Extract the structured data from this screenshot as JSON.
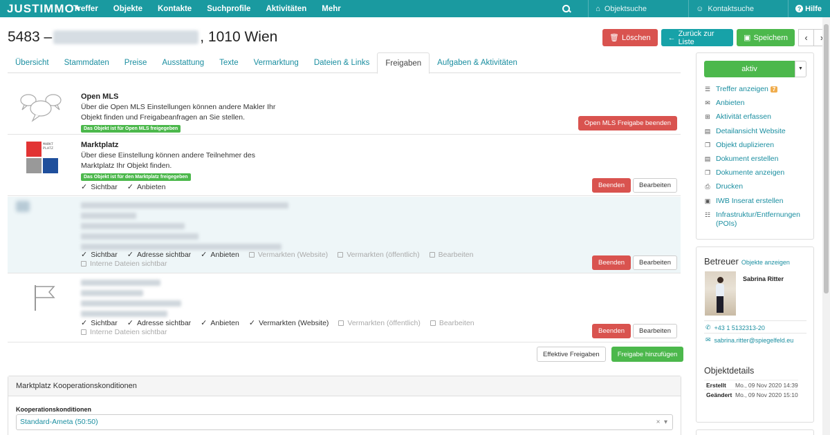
{
  "nav": {
    "brand": "JUSTIMMO",
    "items": [
      "Treffer",
      "Objekte",
      "Kontakte",
      "Suchprofile",
      "Aktivitäten",
      "Mehr"
    ],
    "object_search_placeholder": "Objektsuche",
    "contact_search_placeholder": "Kontaktsuche",
    "help": "Hilfe",
    "color": "#1a9aa0"
  },
  "title": {
    "number": "5483 –",
    "location": ", 1010 Wien"
  },
  "actions": {
    "delete": "Löschen",
    "back": "Zurück zur Liste",
    "save": "Speichern"
  },
  "tabs": [
    "Übersicht",
    "Stammdaten",
    "Preise",
    "Ausstattung",
    "Texte",
    "Vermarktung",
    "Dateien & Links",
    "Freigaben",
    "Aufgaben & Aktivitäten"
  ],
  "active_tab": "Freigaben",
  "open_mls": {
    "title": "Open MLS",
    "desc1": "Über die Open MLS Einstellungen können andere Makler Ihr",
    "desc2": "Objekt finden und Freigabeanfragen an Sie stellen.",
    "badge": "Das Objekt ist für Open MLS freigegeben",
    "button": "Open MLS Freigabe beenden"
  },
  "marktplatz": {
    "title": "Marktplatz",
    "desc1": "Über diese Einstellung können andere Teilnehmer des",
    "desc2": "Marktplatz Ihr Objekt finden.",
    "badge": "Das Objekt ist für den Marktplatz freigegeben",
    "logo_text": "MARKT PLATZ",
    "checks": [
      "Sichtbar",
      "Anbieten"
    ],
    "end_button": "Beenden",
    "edit_button": "Bearbeiten"
  },
  "share3": {
    "checks_on": [
      "Sichtbar",
      "Adresse sichtbar",
      "Anbieten"
    ],
    "checks_off": [
      "Vermarkten (Website)",
      "Vermarkten (öffentlich)",
      "Bearbeiten",
      "Interne Dateien sichtbar"
    ],
    "end_button": "Beenden",
    "edit_button": "Bearbeiten"
  },
  "share4": {
    "checks_on": [
      "Sichtbar",
      "Adresse sichtbar",
      "Anbieten",
      "Vermarkten (Website)"
    ],
    "checks_off": [
      "Vermarkten (öffentlich)",
      "Bearbeiten",
      "Interne Dateien sichtbar"
    ],
    "end_button": "Beenden",
    "edit_button": "Bearbeiten"
  },
  "footer_buttons": {
    "effective": "Effektive Freigaben",
    "add": "Freigabe hinzufügen"
  },
  "cooperation": {
    "heading": "Marktplatz Kooperationskonditionen",
    "label": "Kooperationskonditionen",
    "value": "Standard-Ameta (50:50)"
  },
  "sidebar": {
    "status": "aktiv",
    "links": [
      {
        "icon": "list-icon",
        "glyph": "☰",
        "label": "Treffer anzeigen",
        "count": "7"
      },
      {
        "icon": "envelope-icon",
        "glyph": "✉",
        "label": "Anbieten"
      },
      {
        "icon": "plus-square-icon",
        "glyph": "⊞",
        "label": "Aktivität erfassen"
      },
      {
        "icon": "file-icon",
        "glyph": "▤",
        "label": "Detailansicht Website"
      },
      {
        "icon": "copy-icon",
        "glyph": "❐",
        "label": "Objekt duplizieren"
      },
      {
        "icon": "file-icon",
        "glyph": "▤",
        "label": "Dokument erstellen"
      },
      {
        "icon": "copy-icon",
        "glyph": "❐",
        "label": "Dokumente anzeigen"
      },
      {
        "icon": "print-icon",
        "glyph": "⎙",
        "label": "Drucken"
      },
      {
        "icon": "newspaper-icon",
        "glyph": "▣",
        "label": "IWB Inserat erstellen"
      },
      {
        "icon": "poi-icon",
        "glyph": "☷",
        "label": "Infrastruktur/Entfernungen (POIs)"
      }
    ],
    "agent_heading": "Betreuer",
    "agent_link": "Objekte anzeigen",
    "agent_name": "Sabrina Ritter",
    "agent_phone": "+43 1 5132313-20",
    "agent_email": "sabrina.ritter@spiegelfeld.eu",
    "details_heading": "Objektdetails",
    "details": [
      {
        "key": "Erstellt",
        "value": "Mo., 09 Nov 2020 14:39"
      },
      {
        "key": "Geändert",
        "value": "Mo., 09 Nov 2020 15:10"
      }
    ]
  }
}
